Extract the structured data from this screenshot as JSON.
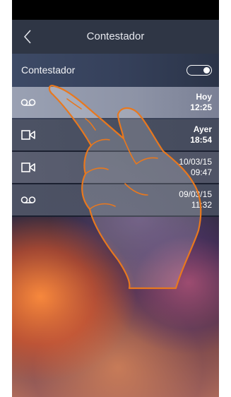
{
  "header": {
    "title": "Contestador",
    "back_icon": "chevron-left-icon"
  },
  "answering_machine": {
    "label": "Contestador",
    "enabled": true
  },
  "messages": [
    {
      "type": "voice",
      "icon": "voicemail-icon",
      "day": "Hoy",
      "time": "12:25",
      "unread": true
    },
    {
      "type": "video",
      "icon": "video-camera-icon",
      "day": "Ayer",
      "time": "18:54",
      "unread": true
    },
    {
      "type": "video",
      "icon": "video-camera-icon",
      "day": "10/03/15",
      "time": "09:47",
      "unread": false
    },
    {
      "type": "voice",
      "icon": "voicemail-icon",
      "day": "09/03/15",
      "time": "11:32",
      "unread": false
    }
  ],
  "colors": {
    "header_bg": "#2f3645",
    "toggle_row_bg": "#3d4a66",
    "selected_row_bg": "#9aa1b3",
    "hand_outline": "#e8781e"
  }
}
